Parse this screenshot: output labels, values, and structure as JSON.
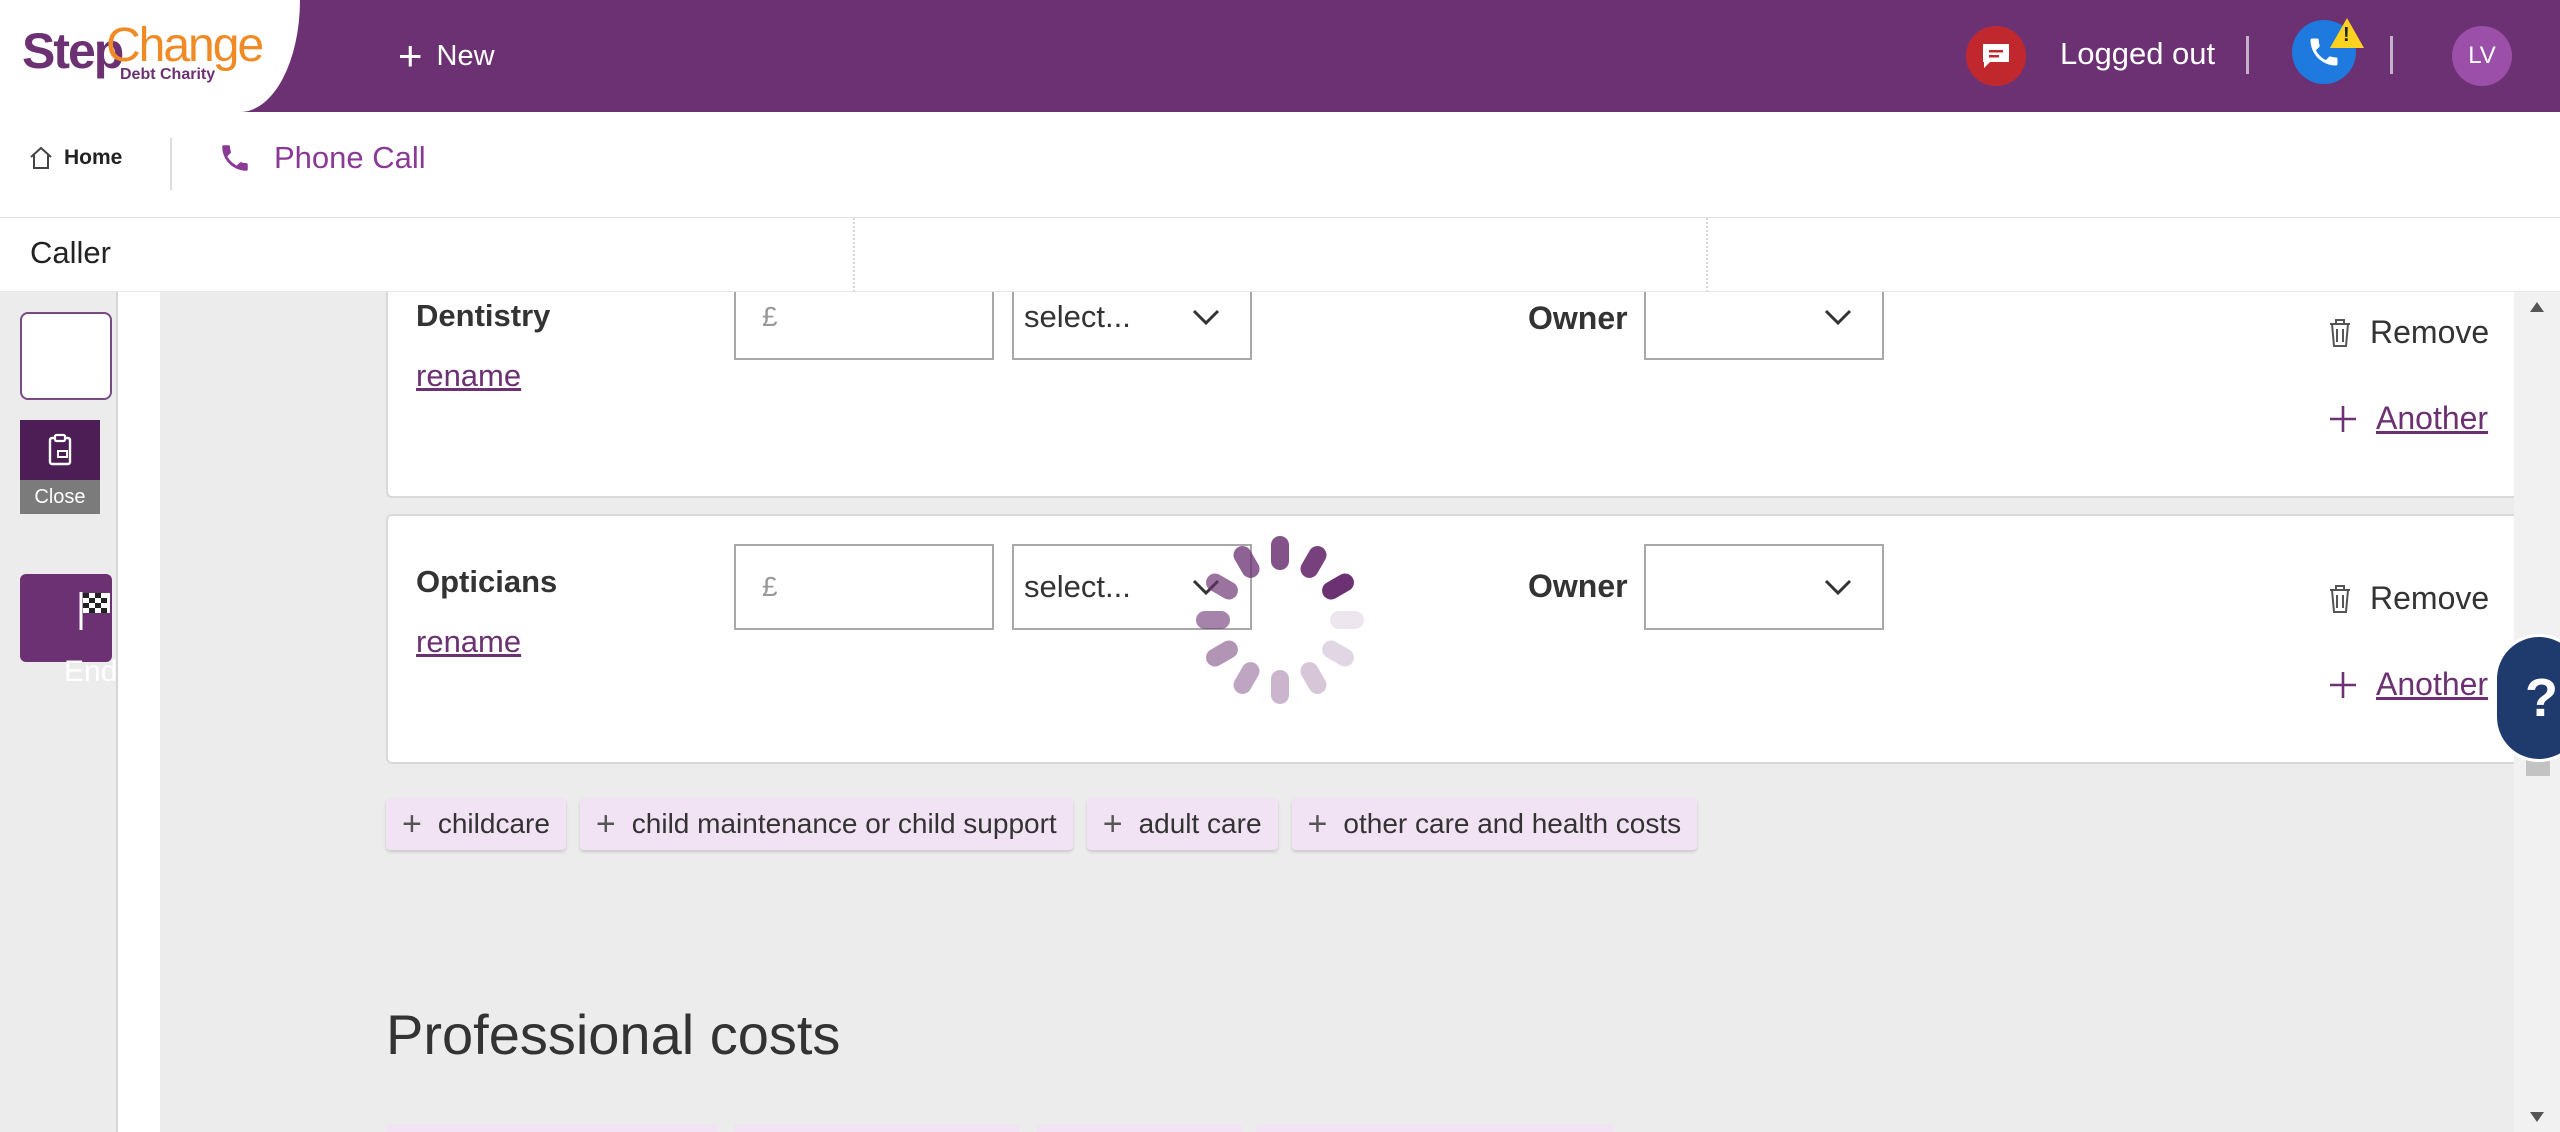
{
  "header": {
    "logo_step": "Step",
    "logo_change": "Change",
    "logo_sub": "Debt Charity",
    "new_label": "New",
    "status_label": "Logged out",
    "warning_mark": "!",
    "avatar_initials": "LV"
  },
  "nav": {
    "home_label": "Home",
    "tab_label": "Phone Call"
  },
  "caller_label": "Caller",
  "left_rail": {
    "close_label": "Close",
    "end_session_label": "End Session"
  },
  "costs": [
    {
      "name": "Dentistry",
      "rename_label": "rename",
      "amount_placeholder": "£",
      "frequency_value": "select...",
      "owner_label": "Owner",
      "owner_value": "",
      "remove_label": "Remove",
      "another_label": "Another"
    },
    {
      "name": "Opticians",
      "rename_label": "rename",
      "amount_placeholder": "£",
      "frequency_value": "select...",
      "owner_label": "Owner",
      "owner_value": "",
      "remove_label": "Remove",
      "another_label": "Another"
    }
  ],
  "add_chips": [
    "childcare",
    "child maintenance or child support",
    "adult care",
    "other care and health costs"
  ],
  "section_title": "Professional costs",
  "help_label": "?",
  "colors": {
    "brand_purple": "#6b3172",
    "brand_orange": "#f08a24",
    "chip_bg": "#f2e3f4",
    "chat_red": "#c0282d",
    "phone_blue": "#1f7ae0",
    "help_navy": "#1f3b6e"
  },
  "icons": {
    "new": "plus-icon",
    "chat": "chat-bubble-icon",
    "phone_status": "phone-icon",
    "warning": "warning-triangle-icon",
    "home": "house-icon",
    "phone_tab": "phone-icon",
    "close": "clipboard-icon",
    "end_session": "checkered-flag-icon",
    "remove": "trash-icon",
    "another": "plus-icon",
    "loading": "spinner-icon"
  }
}
